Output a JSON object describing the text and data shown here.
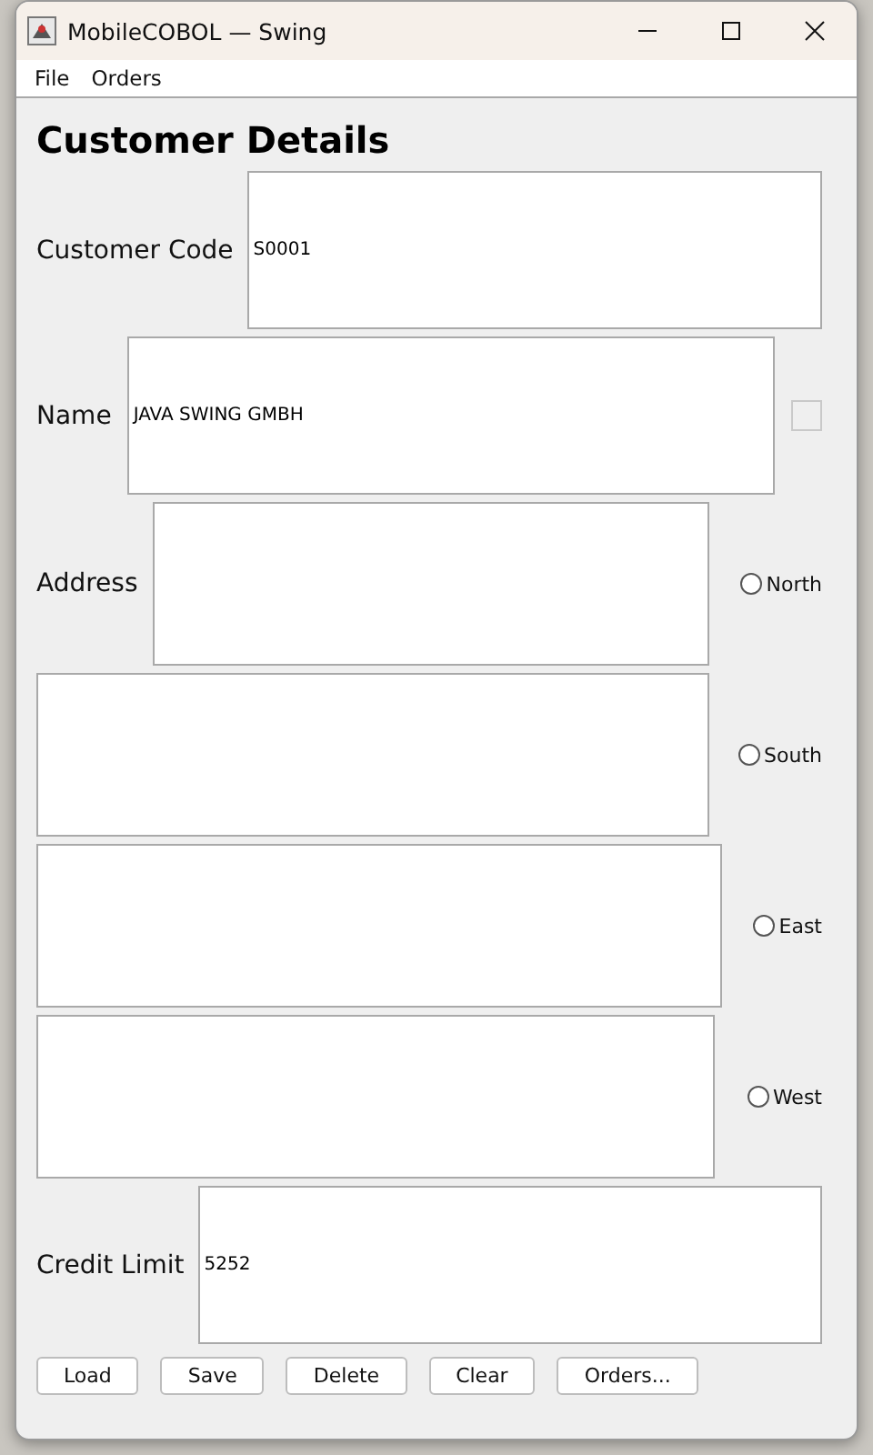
{
  "window": {
    "title": "MobileCOBOL — Swing"
  },
  "menu": [
    {
      "label": "File"
    },
    {
      "label": "Orders"
    }
  ],
  "heading": "Customer Details",
  "customer_code": {
    "label": "Customer Code",
    "value": "S0001"
  },
  "name": {
    "label": "Name",
    "value": "JAVA SWING GMBH",
    "checkbox": {
      "checked": false
    }
  },
  "address": {
    "label": "Address",
    "lines": [
      {
        "radio": {
          "label": "North",
          "selected": false
        }
      },
      {
        "radio": {
          "label": "South",
          "selected": false
        }
      },
      {
        "radio": {
          "label": "East",
          "selected": false
        }
      },
      {
        "radio": {
          "label": "West",
          "selected": false
        }
      }
    ]
  },
  "credit_limit": {
    "label": "Credit Limit",
    "value": "5252"
  },
  "buttons": [
    {
      "label": "Load"
    },
    {
      "label": "Save"
    },
    {
      "label": "Delete"
    },
    {
      "label": "Clear"
    },
    {
      "label": "Orders..."
    }
  ]
}
